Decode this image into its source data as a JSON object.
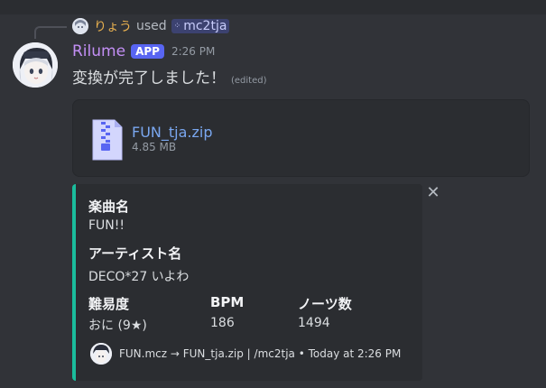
{
  "reply": {
    "username": "りょう",
    "used_text": "used",
    "command": "mc2tja",
    "command_icon": "slash-command-icon"
  },
  "message": {
    "username": "Rilume",
    "app_tag": "APP",
    "timestamp": "2:26 PM",
    "content": "変換が完了しました！",
    "edited": "(edited)"
  },
  "attachment": {
    "file_name": "FUN_tja.zip",
    "file_size": "4.85 MB",
    "icon": "zip-file-icon"
  },
  "embed": {
    "accent_color": "#1abc9c",
    "fields": [
      {
        "name": "楽曲名",
        "value": "FUN!!"
      },
      {
        "name": "アーティスト名",
        "value": "DECO*27 いよわ"
      },
      {
        "name": "難易度",
        "value": "おに (9★)"
      },
      {
        "name": "BPM",
        "value": "186"
      },
      {
        "name": "ノーツ数",
        "value": "1494"
      }
    ],
    "footer": "FUN.mcz → FUN_tja.zip | /mc2tja • Today at 2:26 PM"
  },
  "colors": {
    "background": "#313338",
    "username": "#c38ff5",
    "reply_username": "#e8b04f",
    "link": "#7aa7f0",
    "app_tag": "#5865f2"
  }
}
